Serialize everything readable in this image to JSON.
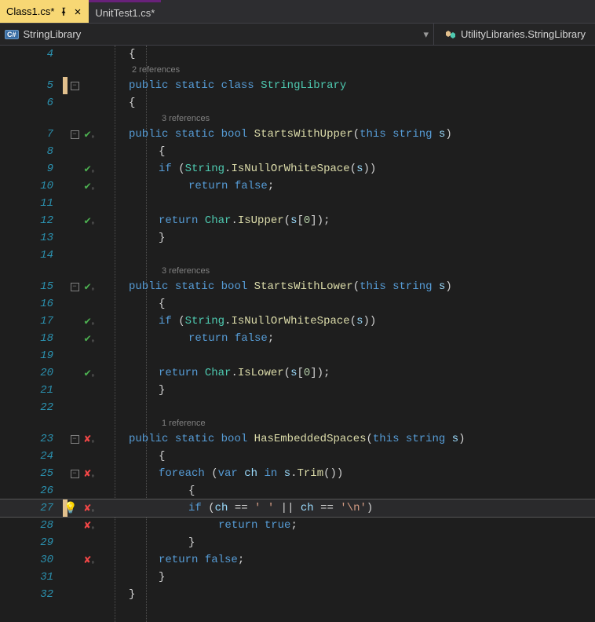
{
  "tabs": {
    "active": "Class1.cs*",
    "inactive": "UnitTest1.cs*"
  },
  "nav": {
    "lang_badge": "C#",
    "left": "StringLibrary",
    "right": "UtilityLibraries.StringLibrary"
  },
  "codelens": {
    "class": "2 references",
    "m1": "3 references",
    "m2": "3 references",
    "m3": "1 reference"
  },
  "lines": {
    "4": "{",
    "6": "{",
    "8": "{",
    "11": "",
    "13": "}",
    "14": "",
    "16": "{",
    "19": "",
    "21": "}",
    "22": "",
    "24": "{",
    "26": "{",
    "29": "}",
    "31": "}",
    "32": "}"
  },
  "tokens": {
    "public": "public",
    "static": "static",
    "class": "class",
    "bool": "bool",
    "this": "this",
    "string": "string",
    "if": "if",
    "return": "return",
    "false": "false",
    "true": "true",
    "foreach": "foreach",
    "var": "var",
    "in": "in",
    "StringLibrary": "StringLibrary",
    "StartsWithUpper": "StartsWithUpper",
    "StartsWithLower": "StartsWithLower",
    "HasEmbeddedSpaces": "HasEmbeddedSpaces",
    "String": "String",
    "Char": "Char",
    "IsNullOrWhiteSpace": "IsNullOrWhiteSpace",
    "IsUpper": "IsUpper",
    "IsLower": "IsLower",
    "Trim": "Trim",
    "s": "s",
    "ch": "ch",
    "zero": "0",
    "space": "' '",
    "nl": "'\\n'",
    "oror": " || ",
    "eqeq": " == "
  },
  "linenos": [
    "4",
    "5",
    "6",
    "7",
    "8",
    "9",
    "10",
    "11",
    "12",
    "13",
    "14",
    "15",
    "16",
    "17",
    "18",
    "19",
    "20",
    "21",
    "22",
    "23",
    "24",
    "25",
    "26",
    "27",
    "28",
    "29",
    "30",
    "31",
    "32"
  ]
}
